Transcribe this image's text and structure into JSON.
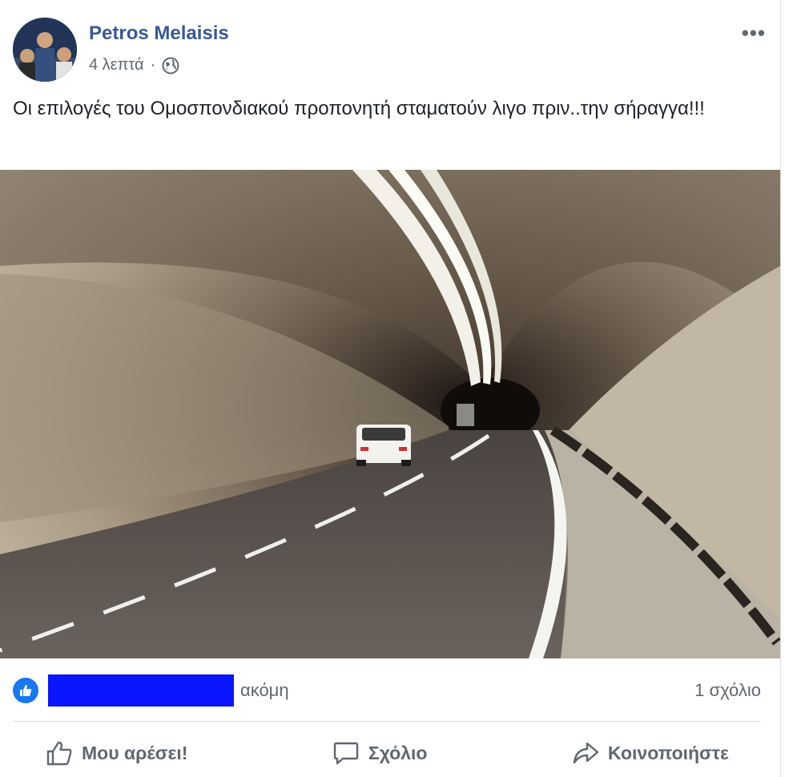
{
  "post": {
    "author": "Petros Melaisis",
    "time": "4 λεπτά",
    "separator": "·",
    "privacy_icon": "globe-icon",
    "more_label": "•••",
    "text": "Οι επιλογές του Ομοσπονδιακού προπονητή σταματούν λιγο πριν..την σήραγγα!!!"
  },
  "reactions": {
    "like_icon": "thumbs-up-icon",
    "more_text": "ακόμη",
    "comments": "1 σχόλιο"
  },
  "actions": {
    "like": "Μου αρέσει!",
    "comment": "Σχόλιο",
    "share": "Κοινοποιήστε"
  },
  "colors": {
    "brand": "#385898",
    "like_blue": "#1877f2",
    "redaction": "#0a16ff",
    "muted": "#606770"
  }
}
